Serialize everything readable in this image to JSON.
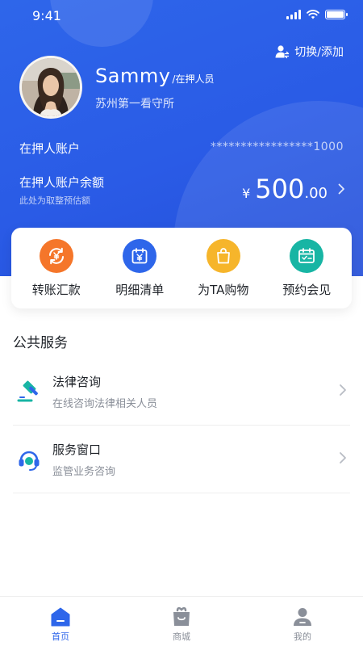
{
  "status_bar": {
    "time": "9:41"
  },
  "header": {
    "switch_label": "切换/添加",
    "user_name": "Sammy",
    "user_role": "/在押人员",
    "facility": "苏州第一看守所",
    "account_label": "在押人账户",
    "account_number": "*****************1000",
    "balance_label": "在押人账户余额",
    "balance_hint": "此处为取整预估额",
    "balance_currency": "¥",
    "balance_integer": "500",
    "balance_decimal": ".00"
  },
  "actions": [
    {
      "label": "转账汇款",
      "icon": "transfer-yuan-icon",
      "color": "#f5762a"
    },
    {
      "label": "明细清单",
      "icon": "calendar-yuan-icon",
      "color": "#2e66ea"
    },
    {
      "label": "为TA购物",
      "icon": "shopping-bag-icon",
      "color": "#f6b52b"
    },
    {
      "label": "预约会见",
      "icon": "calendar-check-icon",
      "color": "#18b5a4"
    }
  ],
  "public_services": {
    "title": "公共服务",
    "items": [
      {
        "title": "法律咨询",
        "subtitle": "在线咨询法律相关人员",
        "icon": "gavel-icon"
      },
      {
        "title": "服务窗口",
        "subtitle": "监管业务咨询",
        "icon": "headset-icon"
      }
    ]
  },
  "tabbar": {
    "items": [
      {
        "label": "首页",
        "icon": "home-icon",
        "active": true
      },
      {
        "label": "商城",
        "icon": "shop-icon",
        "active": false
      },
      {
        "label": "我的",
        "icon": "person-icon",
        "active": false
      }
    ]
  },
  "colors": {
    "primary": "#2e66ea",
    "text": "#1f2329",
    "subtext": "#8a8f99"
  }
}
